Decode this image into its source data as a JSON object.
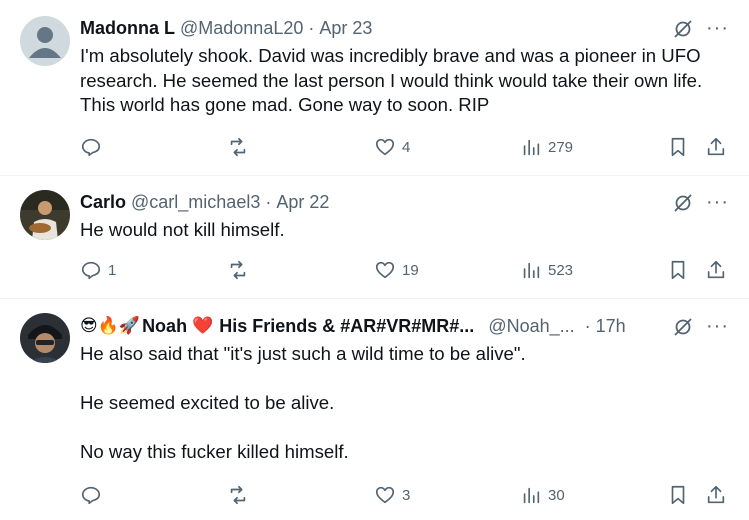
{
  "tweets": [
    {
      "name": "Madonna L",
      "handle": "@MadonnaL20",
      "date": "Apr 23",
      "text": "I'm absolutely shook. David was incredibly brave and was a pioneer in UFO research. He seemed the last person I would think would take their own life. This world has gone mad. Gone way to soon.  RIP",
      "reply_count": "",
      "repost_count": "",
      "like_count": "4",
      "view_count": "279"
    },
    {
      "name": "Carlo",
      "handle": "@carl_michael3",
      "date": "Apr 22",
      "text": "He would not kill himself.",
      "reply_count": "1",
      "repost_count": "",
      "like_count": "19",
      "view_count": "523"
    },
    {
      "name_prefix": "😎🔥🚀",
      "name": "Noah",
      "name_heart": "❤️",
      "name_suffix": "His Friends & #AR#VR#MR#...",
      "handle": "@Noah_...",
      "date": "17h",
      "text": "He also said that \"it's just such a wild time to be alive\".\n\nHe seemed excited to be alive.\n\nNo way this fucker killed himself.",
      "reply_count": "",
      "repost_count": "",
      "like_count": "3",
      "view_count": "30"
    }
  ],
  "icons": {
    "grok": "grok-icon",
    "more": "more-icon",
    "reply": "reply-icon",
    "repost": "repost-icon",
    "like": "like-icon",
    "views": "views-icon",
    "bookmark": "bookmark-icon",
    "share": "share-icon"
  },
  "colors": {
    "text": "#0f1419",
    "secondary": "#536471",
    "divider": "#eff3f4"
  }
}
